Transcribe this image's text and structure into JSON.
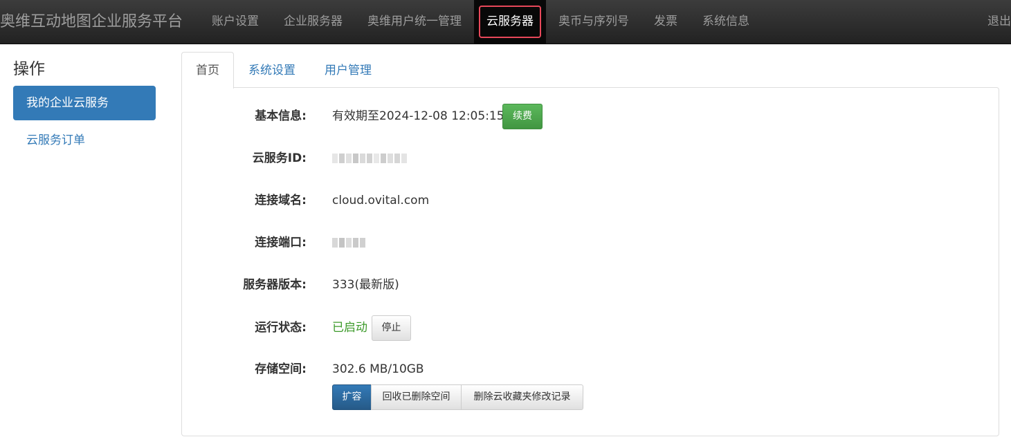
{
  "navbar": {
    "brand": "奥维互动地图企业服务平台",
    "items": [
      {
        "label": "账户设置"
      },
      {
        "label": "企业服务器"
      },
      {
        "label": "奥维用户统一管理"
      },
      {
        "label": "云服务器"
      },
      {
        "label": "奥币与序列号"
      },
      {
        "label": "发票"
      },
      {
        "label": "系统信息"
      }
    ],
    "logout": "退出"
  },
  "sidebar": {
    "title": "操作",
    "items": [
      {
        "label": "我的企业云服务"
      },
      {
        "label": "云服务订单"
      }
    ]
  },
  "tabs": [
    {
      "label": "首页"
    },
    {
      "label": "系统设置"
    },
    {
      "label": "用户管理"
    }
  ],
  "info": {
    "basic": {
      "label": "基本信息:",
      "value": "有效期至2024-12-08 12:05:15",
      "renew_button": "续费"
    },
    "cloud_id": {
      "label": "云服务ID:"
    },
    "domain": {
      "label": "连接域名:",
      "value": "cloud.ovital.com"
    },
    "port": {
      "label": "连接端口:"
    },
    "version": {
      "label": "服务器版本:",
      "value": "333(最新版)"
    },
    "status": {
      "label": "运行状态:",
      "value": "已启动",
      "stop_button": "停止"
    },
    "storage": {
      "label": "存储空间:",
      "value": "302.6 MB/10GB",
      "expand_button": "扩容",
      "reclaim_button": "回收已删除空间",
      "delete_button": "删除云收藏夹修改记录"
    }
  },
  "colors": {
    "primary": "#337ab7",
    "success": "#5cb85c",
    "status_running": "#3c9a2a",
    "highlight": "#e8485a"
  }
}
